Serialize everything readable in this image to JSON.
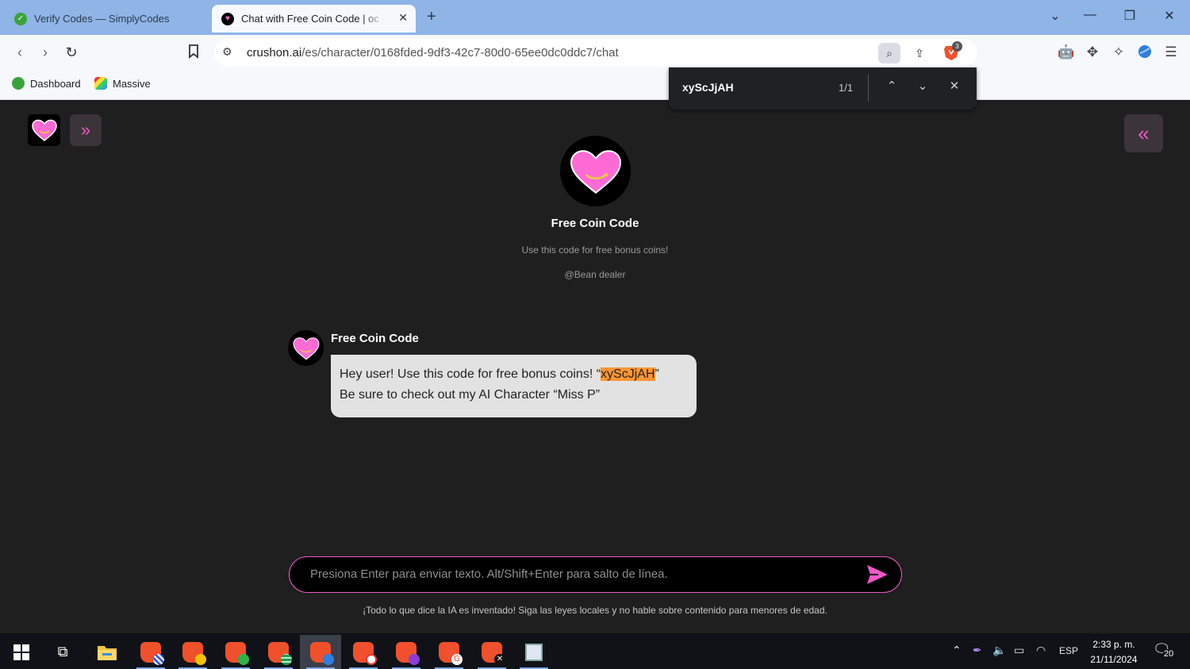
{
  "browser": {
    "tabs": [
      {
        "title": "Verify Codes — SimplyCodes",
        "active": false
      },
      {
        "title": "Chat with Free Coin Code | oc n",
        "active": true
      }
    ],
    "url_host": "crushon.ai",
    "url_path": "/es/character/0168fded-9df3-42c7-80d0-65ee0dc0ddc7/chat",
    "brave_badge": "3",
    "bookmarks": [
      "Dashboard",
      "Massive"
    ]
  },
  "findbar": {
    "query": "xyScJjAH",
    "count": "1/1"
  },
  "character": {
    "name": "Free Coin Code",
    "description": "Use this code for free bonus coins!",
    "author": "@Bean dealer"
  },
  "message": {
    "sender": "Free Coin Code",
    "text_before": "Hey user! Use this code for free bonus coins! “",
    "code": "xyScJjAH",
    "text_after": "”",
    "line2": "Be sure to check out my AI Character “Miss P”"
  },
  "composer": {
    "placeholder": "Presiona Enter para enviar texto. Alt/Shift+Enter para salto de línea."
  },
  "disclaimer": "¡Todo lo que dice la IA es inventado! Siga las leyes locales y no hable sobre contenido para menores de edad.",
  "taskbar": {
    "language": "ESP",
    "time": "2:33 p. m.",
    "date": "21/11/2024",
    "notifications": "20"
  },
  "colors": {
    "accent_pink": "#f257c9",
    "heart_pink": "#ff6ad5",
    "highlight": "#ff9632"
  }
}
